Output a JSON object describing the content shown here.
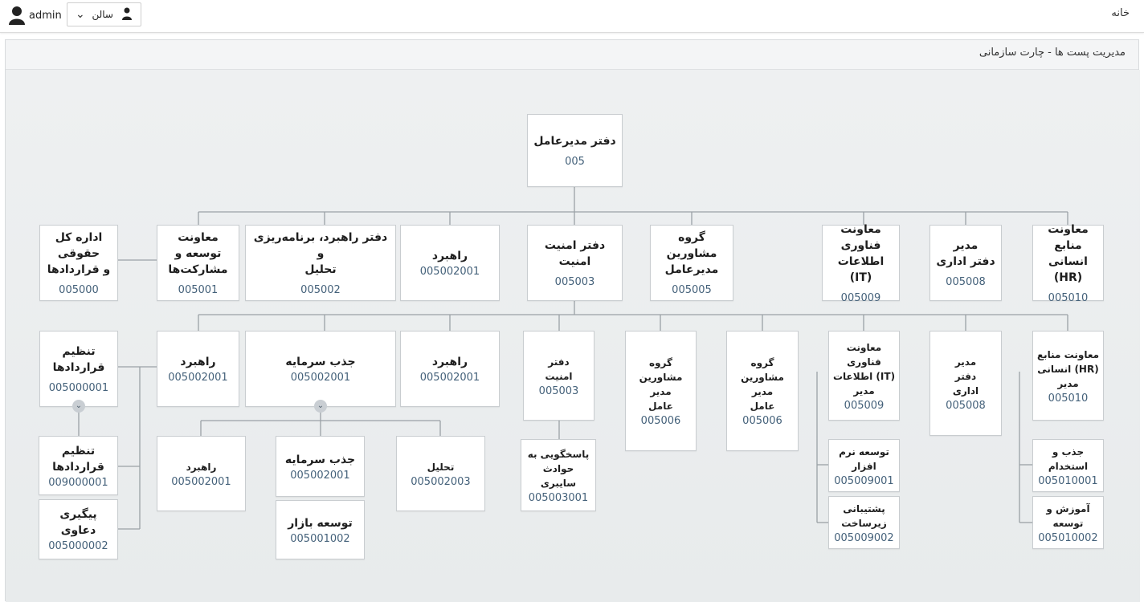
{
  "header": {
    "home_label": "خانه",
    "username": "admin",
    "org_select_value": "سالن"
  },
  "page": {
    "title": "مدیریت پست ها - چارت سازمانی"
  },
  "nodes": {
    "root": {
      "title": "دفتر مدیرعامل",
      "code": "005"
    },
    "l1_hr": {
      "title": "معاونت منابع\nانسانی (HR)",
      "code": "005010"
    },
    "l1_admin": {
      "title": "مدیر\nدفتر اداری",
      "code": "005008"
    },
    "l1_it": {
      "title": "معاونت فناوری\nاطلاعات (IT)",
      "code": "005009"
    },
    "l1_advisors": {
      "title": "گروه مشاورین\nمدیرعامل",
      "code": "005005"
    },
    "l1_security": {
      "title": "دفتر امنیت\nامنیت",
      "code": "005003"
    },
    "l1_strategy": {
      "title": "راهبرد",
      "code": "005002001"
    },
    "l1_strategy_office": {
      "title": "دفتر راهبرد، برنامه‌ریزی و\nتحلیل",
      "code": "005002"
    },
    "l1_development": {
      "title": "معاونت توسعه و\nمشارکت‌ها",
      "code": "005001"
    },
    "l1_legal": {
      "title": "اداره کل حقوقی\nو قراردادها",
      "code": "005000"
    },
    "l2_hr": {
      "title": "معاونت منابع\nانسانی (HR)\nمدیر",
      "code": "005010"
    },
    "l2_admin": {
      "title": "مدیر\nدفتر\nاداری",
      "code": "005008"
    },
    "l2_it": {
      "title": "معاونت فناوری\nاطلاعات (IT)\nمدیر",
      "code": "005009"
    },
    "l2_advisors_a": {
      "title": "گروه\nمشاورین\nمدیر\nعامل",
      "code": "005006"
    },
    "l2_advisors_b": {
      "title": "گروه\nمشاورین\nمدیر\nعامل",
      "code": "005006"
    },
    "l2_security": {
      "title": "دفتر\nامنیت",
      "code": "005003"
    },
    "l2_strategy": {
      "title": "راهبرد",
      "code": "005002001"
    },
    "l2_investment": {
      "title": "جذب سرمایه",
      "code": "005002001"
    },
    "l2_strategy_b": {
      "title": "راهبرد",
      "code": "005002001"
    },
    "l2_contracts": {
      "title": "تنظیم قراردادها",
      "code": "005000001"
    },
    "l3_recruit": {
      "title": "جذب و استخدام",
      "code": "005010001"
    },
    "l3_training": {
      "title": "آموزش و توسعه",
      "code": "005010002"
    },
    "l3_software": {
      "title": "توسعه نرم افزار",
      "code": "005009001"
    },
    "l3_infra": {
      "title": "پشتیبانی زیرساخت",
      "code": "005009002"
    },
    "l3_incident": {
      "title": "پاسخگویی به\nحوادث سایبری",
      "code": "005003001"
    },
    "l3_analysis": {
      "title": "تحلیل",
      "code": "005002003"
    },
    "l3_investment": {
      "title": "جذب سرمایه",
      "code": "005002001"
    },
    "l3_market": {
      "title": "توسعه بازار",
      "code": "005001002"
    },
    "l3_strategy": {
      "title": "راهبرد",
      "code": "005002001"
    },
    "l3_contracts": {
      "title": "تنظیم قراردادها",
      "code": "009000001"
    },
    "l3_lawsuits": {
      "title": "پیگیری دعاوی",
      "code": "005000002"
    }
  }
}
